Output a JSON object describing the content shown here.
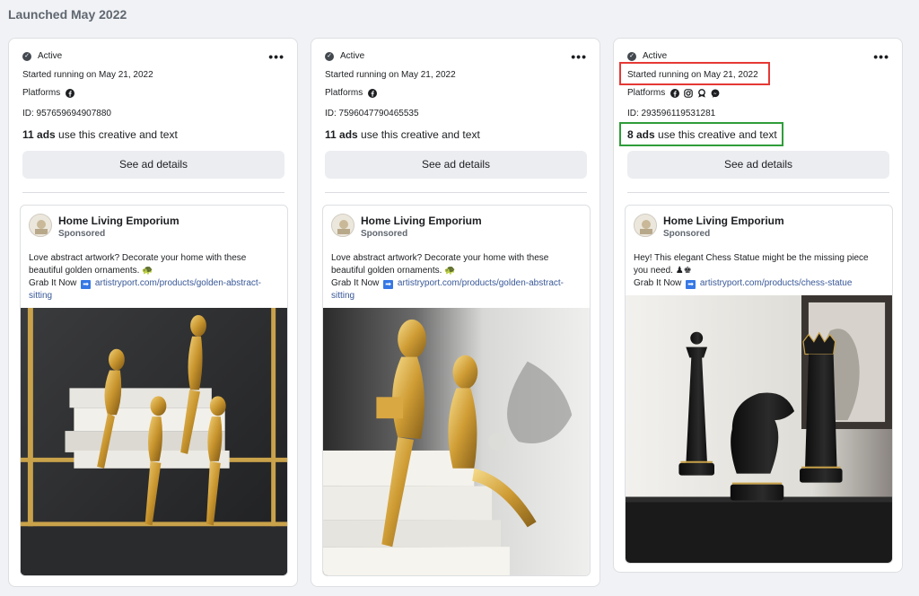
{
  "section": {
    "title": "Launched May 2022"
  },
  "colors": {
    "highlight_red": "#e53935",
    "highlight_green": "#2e9d3a",
    "link": "#385898"
  },
  "cards": [
    {
      "status": "Active",
      "started": "Started running on May 21, 2022",
      "platforms_label": "Platforms",
      "platforms": [
        "facebook-icon"
      ],
      "id": "ID: 957659694907880",
      "ads_bold": "11 ads",
      "ads_rest": " use this creative and text",
      "details_label": "See ad details",
      "preview": {
        "advertiser": "Home Living Emporium",
        "sponsored": "Sponsored",
        "text_1": "Love abstract artwork? Decorate your home with these beautiful golden ornaments. 🐢",
        "grab": "Grab It Now",
        "link": "artistryport.com/products/golden-abstract-sitting"
      }
    },
    {
      "status": "Active",
      "started": "Started running on May 21, 2022",
      "platforms_label": "Platforms",
      "platforms": [
        "facebook-icon"
      ],
      "id": "ID: 7596047790465535",
      "ads_bold": "11 ads",
      "ads_rest": " use this creative and text",
      "details_label": "See ad details",
      "preview": {
        "advertiser": "Home Living Emporium",
        "sponsored": "Sponsored",
        "text_1": "Love abstract artwork? Decorate your home with these beautiful golden ornaments. 🐢",
        "grab": "Grab It Now",
        "link": "artistryport.com/products/golden-abstract-sitting"
      }
    },
    {
      "status": "Active",
      "started": "Started running on May 21, 2022",
      "platforms_label": "Platforms",
      "platforms": [
        "facebook-icon",
        "instagram-icon",
        "audience-network-icon",
        "messenger-icon"
      ],
      "id": "ID: 293596119531281",
      "ads_bold": "8 ads",
      "ads_rest": " use this creative and text",
      "details_label": "See ad details",
      "preview": {
        "advertiser": "Home Living Emporium",
        "sponsored": "Sponsored",
        "text_1": "Hey! This elegant Chess Statue might be the missing piece you need. ♟♚",
        "grab": "Grab It Now",
        "link": "artistryport.com/products/chess-statue"
      }
    }
  ]
}
